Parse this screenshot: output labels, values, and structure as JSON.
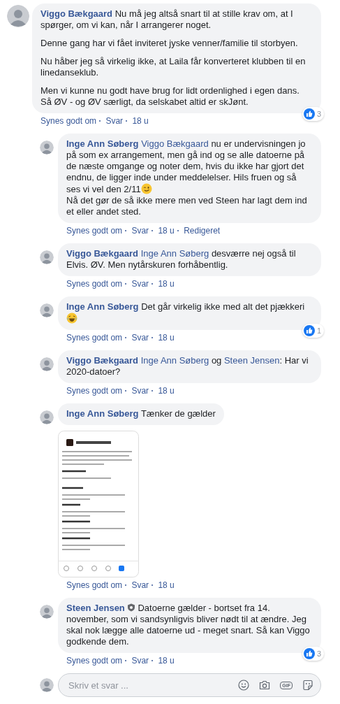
{
  "comments": [
    {
      "kind": "comment",
      "author": "Viggo Bækgaard",
      "admin": false,
      "paragraphs": [
        [
          {
            "kind": "text",
            "text": "Nu må jeg altså snart til at stille krav om, at I spørger, om vi kan, når I arrangerer noget."
          }
        ],
        [
          {
            "kind": "text",
            "text": "Denne gang har vi fået inviteret jyske venner/familie til storbyen."
          }
        ],
        [
          {
            "kind": "text",
            "text": "Nu håber jeg så virkelig ikke, at Laila får konverteret klubben til en linedanseklub."
          }
        ],
        [
          {
            "kind": "text",
            "text": "Men vi kunne nu godt have brug for lidt ordenlighed i egen dans. Så ØV - og ØV særligt, da selskabet altid er skJønt."
          }
        ]
      ],
      "reactions": "3",
      "actions": [
        "Synes godt om",
        "Svar",
        "18 u"
      ]
    },
    {
      "kind": "reply",
      "author": "Inge Ann Søberg",
      "admin": false,
      "paragraphs": [
        [
          {
            "kind": "mention",
            "text": "Viggo Bækgaard"
          },
          {
            "kind": "text",
            "text": " nu er undervisningen jo på som ex arrangement, men gå ind og se alle datoerne på de næste omgange og noter dem, hvis du ikke har gjort det endnu, de ligger inde under meddelelser. Hils fruen og så ses vi vel den 2/11"
          },
          {
            "kind": "wink-emoji"
          },
          {
            "kind": "break"
          },
          {
            "kind": "text",
            "text": "Nå det gør de så ikke mere men ved Steen har lagt dem ind et eller andet sted."
          }
        ]
      ],
      "actions": [
        "Synes godt om",
        "Svar",
        "18 u",
        "Redigeret"
      ]
    },
    {
      "kind": "reply",
      "author": "Viggo Bækgaard",
      "admin": false,
      "paragraphs": [
        [
          {
            "kind": "mention",
            "text": "Inge Ann Søberg"
          },
          {
            "kind": "text",
            "text": " desværre nej også til Elvis. ØV. Men nytårskuren forhåbentlig."
          }
        ]
      ],
      "actions": [
        "Synes godt om",
        "Svar",
        "18 u"
      ]
    },
    {
      "kind": "reply",
      "author": "Inge Ann Søberg",
      "admin": false,
      "paragraphs": [
        [
          {
            "kind": "text",
            "text": "Det går virkelig ikke med alt det pjækkeri "
          },
          {
            "kind": "laugh-emoji"
          }
        ]
      ],
      "reactions": "1",
      "actions": [
        "Synes godt om",
        "Svar",
        "18 u"
      ]
    },
    {
      "kind": "reply",
      "author": "Viggo Bækgaard",
      "admin": false,
      "paragraphs": [
        [
          {
            "kind": "mention",
            "text": "Inge Ann Søberg"
          },
          {
            "kind": "text",
            "text": " og "
          },
          {
            "kind": "mention",
            "text": "Steen Jensen"
          },
          {
            "kind": "text",
            "text": ": Har vi 2020-datoer?"
          }
        ]
      ],
      "actions": [
        "Synes godt om",
        "Svar",
        "18 u"
      ]
    },
    {
      "kind": "reply",
      "author": "Inge Ann Søberg",
      "admin": false,
      "paragraphs": [
        [
          {
            "kind": "text",
            "text": "Tænker de gælder"
          }
        ]
      ],
      "attachment": {
        "kind": "picture"
      },
      "actions": [
        "Synes godt om",
        "Svar",
        "18 u"
      ]
    },
    {
      "kind": "reply",
      "author": "Steen Jensen",
      "admin": true,
      "paragraphs": [
        [
          {
            "kind": "text",
            "text": "Datoerne gælder - bortset fra 14. november, som vi sandsynligvis bliver nødt til at ændre. Jeg skal nok lægge alle datoerne ud - meget snart. Så kan Viggo godkende dem."
          }
        ]
      ],
      "reactions": "3",
      "actions": [
        "Synes godt om",
        "Svar",
        "18 u"
      ]
    }
  ],
  "reply_box": {
    "placeholder": "Skriv et svar ...",
    "gif_label": "GIF"
  }
}
